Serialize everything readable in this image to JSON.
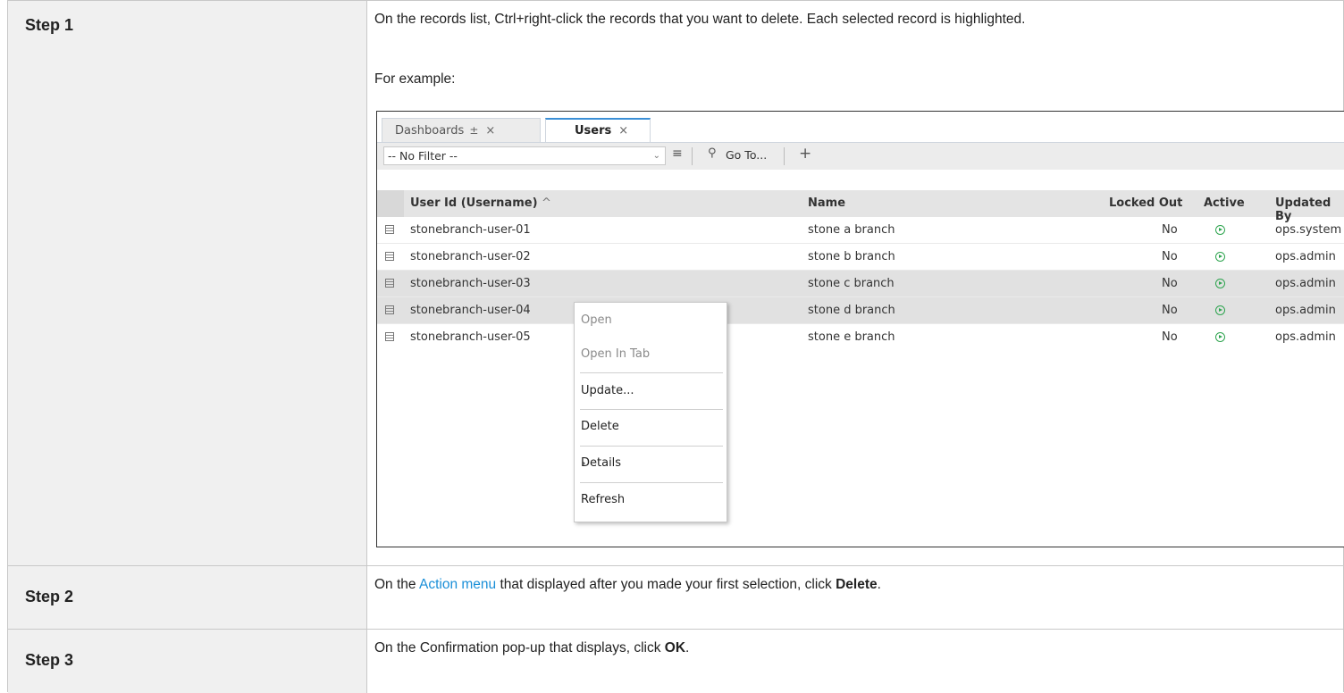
{
  "steps": [
    {
      "label": "Step 1",
      "text": "On the records list, Ctrl+right-click the records that you want to delete. Each selected record is highlighted.",
      "example_label": "For example:"
    },
    {
      "label": "Step 2",
      "text_before": "On the ",
      "link": "Action menu",
      "text_middle": " that displayed after you made your first selection, click ",
      "bold": "Delete",
      "text_after": "."
    },
    {
      "label": "Step 3",
      "text_before": "On the Confirmation pop-up that displays, click ",
      "bold": "OK",
      "text_after": "."
    }
  ],
  "screenshot": {
    "tabs": [
      {
        "label": "Dashboards",
        "pin": "±",
        "close": "×"
      },
      {
        "label": "Users",
        "close": "×"
      }
    ],
    "toolbar": {
      "filter_value": "-- No Filter --",
      "goto_label": "Go To...",
      "add": "+"
    },
    "columns": [
      "User Id (Username)",
      "Name",
      "Locked Out",
      "Active",
      "Updated By"
    ],
    "sort_indicator": "^",
    "rows": [
      {
        "user_id": "stonebranch-user-01",
        "name": "stone a branch",
        "locked_out": "No",
        "updated_by": "ops.system",
        "selected": false
      },
      {
        "user_id": "stonebranch-user-02",
        "name": "stone b branch",
        "locked_out": "No",
        "updated_by": "ops.admin",
        "selected": false
      },
      {
        "user_id": "stonebranch-user-03",
        "name": "stone c branch",
        "locked_out": "No",
        "updated_by": "ops.admin",
        "selected": true
      },
      {
        "user_id": "stonebranch-user-04",
        "name": "stone d branch",
        "locked_out": "No",
        "updated_by": "ops.admin",
        "selected": true
      },
      {
        "user_id": "stonebranch-user-05",
        "name": "stone e branch",
        "locked_out": "No",
        "updated_by": "ops.admin",
        "selected": false
      }
    ],
    "context_menu": [
      {
        "label": "Open",
        "disabled": true
      },
      {
        "label": "Open In Tab",
        "disabled": true
      },
      {
        "label": "Update...",
        "disabled": false
      },
      {
        "label": "Delete",
        "disabled": false
      },
      {
        "label": "Details",
        "disabled": false,
        "submenu": true
      },
      {
        "label": "Refresh",
        "disabled": false
      }
    ],
    "colors": {
      "active_green": "#2ea44f",
      "link_blue": "#1a8fd8",
      "tab_accent": "#3b8fd6"
    }
  }
}
